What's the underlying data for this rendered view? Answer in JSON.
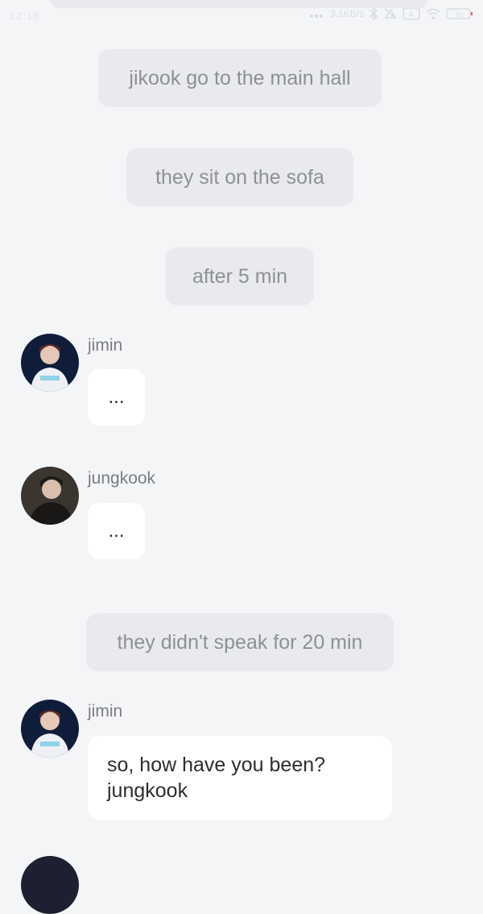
{
  "status_bar": {
    "time": "12:18",
    "signal_icon": "signal-icon",
    "speed": "3.1KB/s",
    "bluetooth_icon": "bluetooth-icon",
    "mute_icon": "mute-icon",
    "sim_icon": "sim-icon",
    "wifi_icon": "wifi-icon",
    "battery_icon": "battery-icon",
    "battery_level": "30"
  },
  "chat": {
    "narrations": [
      "jikook go to the main hall",
      "they sit on the sofa",
      "after 5 min",
      "they didn't speak for 20 min"
    ],
    "messages": [
      {
        "sender": "jimin",
        "text": "...",
        "avatar": "avatar-jimin"
      },
      {
        "sender": "jungkook",
        "text": "...",
        "avatar": "avatar-jungkook"
      },
      {
        "sender": "jimin",
        "text": "so, how have you been? jungkook",
        "avatar": "avatar-jimin"
      }
    ]
  }
}
